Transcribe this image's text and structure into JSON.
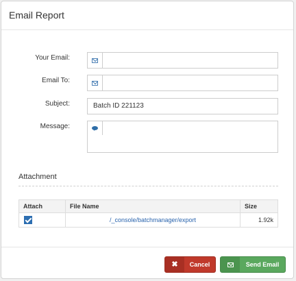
{
  "dialog": {
    "title": "Email Report"
  },
  "form": {
    "your_email": {
      "label": "Your Email:",
      "value": ""
    },
    "email_to": {
      "label": "Email To:",
      "value": ""
    },
    "subject": {
      "label": "Subject:",
      "value": "Batch ID 221123"
    },
    "message": {
      "label": "Message:",
      "value": ""
    }
  },
  "attachment": {
    "title": "Attachment",
    "columns": [
      "Attach",
      "File Name",
      "Size"
    ],
    "rows": [
      {
        "attach": true,
        "file_name": "/_console/batchmanager/export",
        "size": "1.92k"
      }
    ]
  },
  "footer": {
    "cancel_label": "Cancel",
    "send_label": "Send Email"
  },
  "icons": {
    "email": "envelope-icon",
    "message": "comment-icon",
    "cancel": "close-icon",
    "send": "envelope-icon"
  },
  "colors": {
    "cancel": "#c0392b",
    "send": "#5aa85e",
    "link": "#2a64ad"
  }
}
